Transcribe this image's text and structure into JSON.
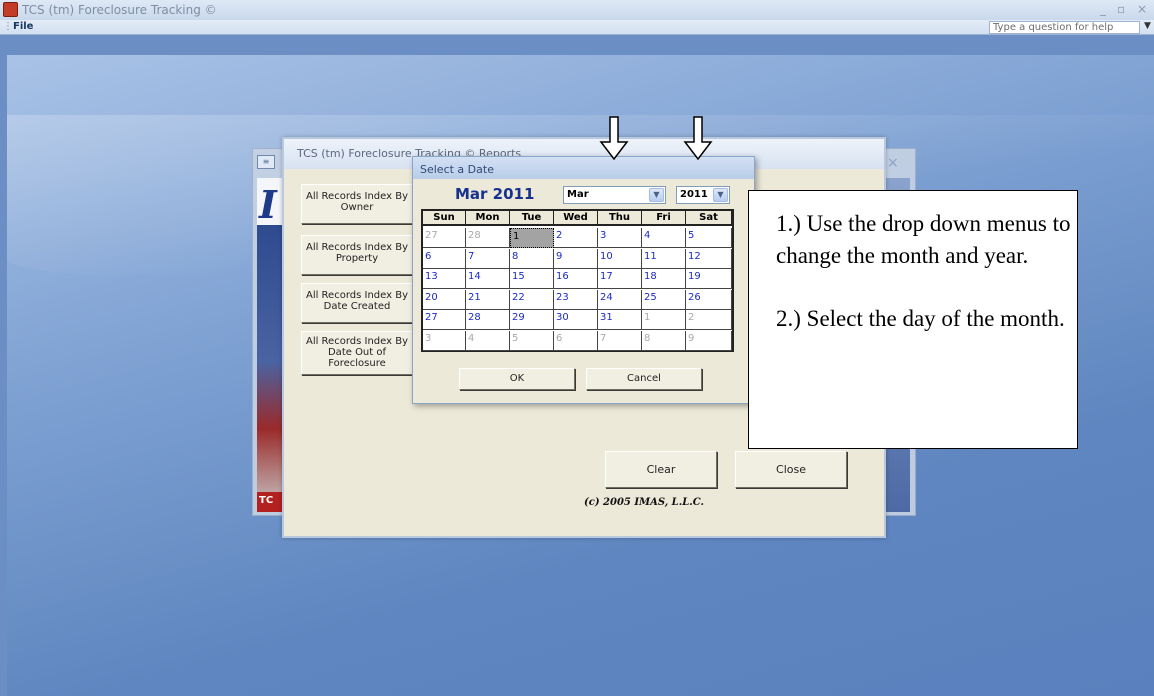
{
  "window": {
    "title": "TCS (tm) Foreclosure Tracking ©",
    "controls": [
      "_",
      "▫",
      "×"
    ]
  },
  "menu": {
    "file": "File",
    "help_placeholder": "Type a question for help"
  },
  "reports_window": {
    "title": "TCS (tm) Foreclosure Tracking ©  Reports",
    "buttons": [
      {
        "label": "All Records Index By Owner"
      },
      {
        "label": "All Records Index By Property"
      },
      {
        "label": "All Records Index By Date Created"
      },
      {
        "label": "All Records Index By Date Out of Foreclosure"
      }
    ],
    "clear_label": "Clear",
    "close_label": "Close",
    "copyright": "(c) 2005 IMAS, L.L.C."
  },
  "date_dialog": {
    "title": "Select a Date",
    "month_year_label": "Mar 2011",
    "month_select": "Mar",
    "year_select": "2011",
    "weekdays": [
      "Sun",
      "Mon",
      "Tue",
      "Wed",
      "Thu",
      "Fri",
      "Sat"
    ],
    "weeks": [
      [
        "27",
        "28",
        "1",
        "2",
        "3",
        "4",
        "5"
      ],
      [
        "6",
        "7",
        "8",
        "9",
        "10",
        "11",
        "12"
      ],
      [
        "13",
        "14",
        "15",
        "16",
        "17",
        "18",
        "19"
      ],
      [
        "20",
        "21",
        "22",
        "23",
        "24",
        "25",
        "26"
      ],
      [
        "27",
        "28",
        "29",
        "30",
        "31",
        "1",
        "2"
      ],
      [
        "3",
        "4",
        "5",
        "6",
        "7",
        "8",
        "9"
      ]
    ],
    "selected_day": "1",
    "ok_label": "OK",
    "cancel_label": "Cancel"
  },
  "callout": {
    "step1": "1.) Use the drop down menus to change the month and year.",
    "step2": "2.) Select the day of the month."
  },
  "background_window": {
    "logo_text": "TC"
  }
}
